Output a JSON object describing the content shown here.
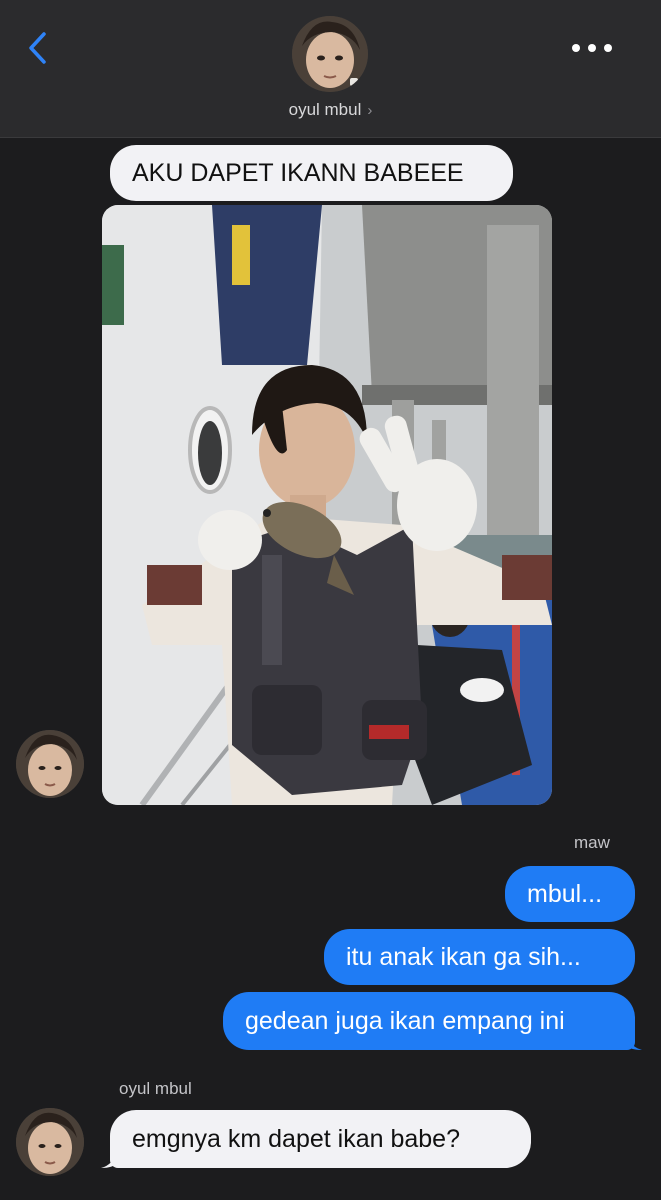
{
  "header": {
    "contact_name": "oyul mbul",
    "back_icon": "chevron-left-icon",
    "more_icon": "ellipsis-icon",
    "accent_color": "#2f83f7"
  },
  "messages": [
    {
      "direction": "incoming",
      "text": "AKU DAPET IKANN BABEEE"
    },
    {
      "direction": "incoming",
      "type": "photo",
      "icon": "photo-fishing-boat"
    },
    {
      "direction": "outgoing",
      "sender": "maw",
      "text": "mbul..."
    },
    {
      "direction": "outgoing",
      "text": "itu anak ikan ga sih..."
    },
    {
      "direction": "outgoing",
      "text": "gedean juga ikan empang ini"
    },
    {
      "direction": "incoming",
      "sender": "oyul mbul",
      "text": "emgnya km dapet ikan babe?"
    }
  ],
  "colors": {
    "background": "#1c1c1e",
    "header_bg": "#2b2b2d",
    "incoming_bubble": "#f2f2f5",
    "outgoing_bubble": "#1f7cf5"
  }
}
